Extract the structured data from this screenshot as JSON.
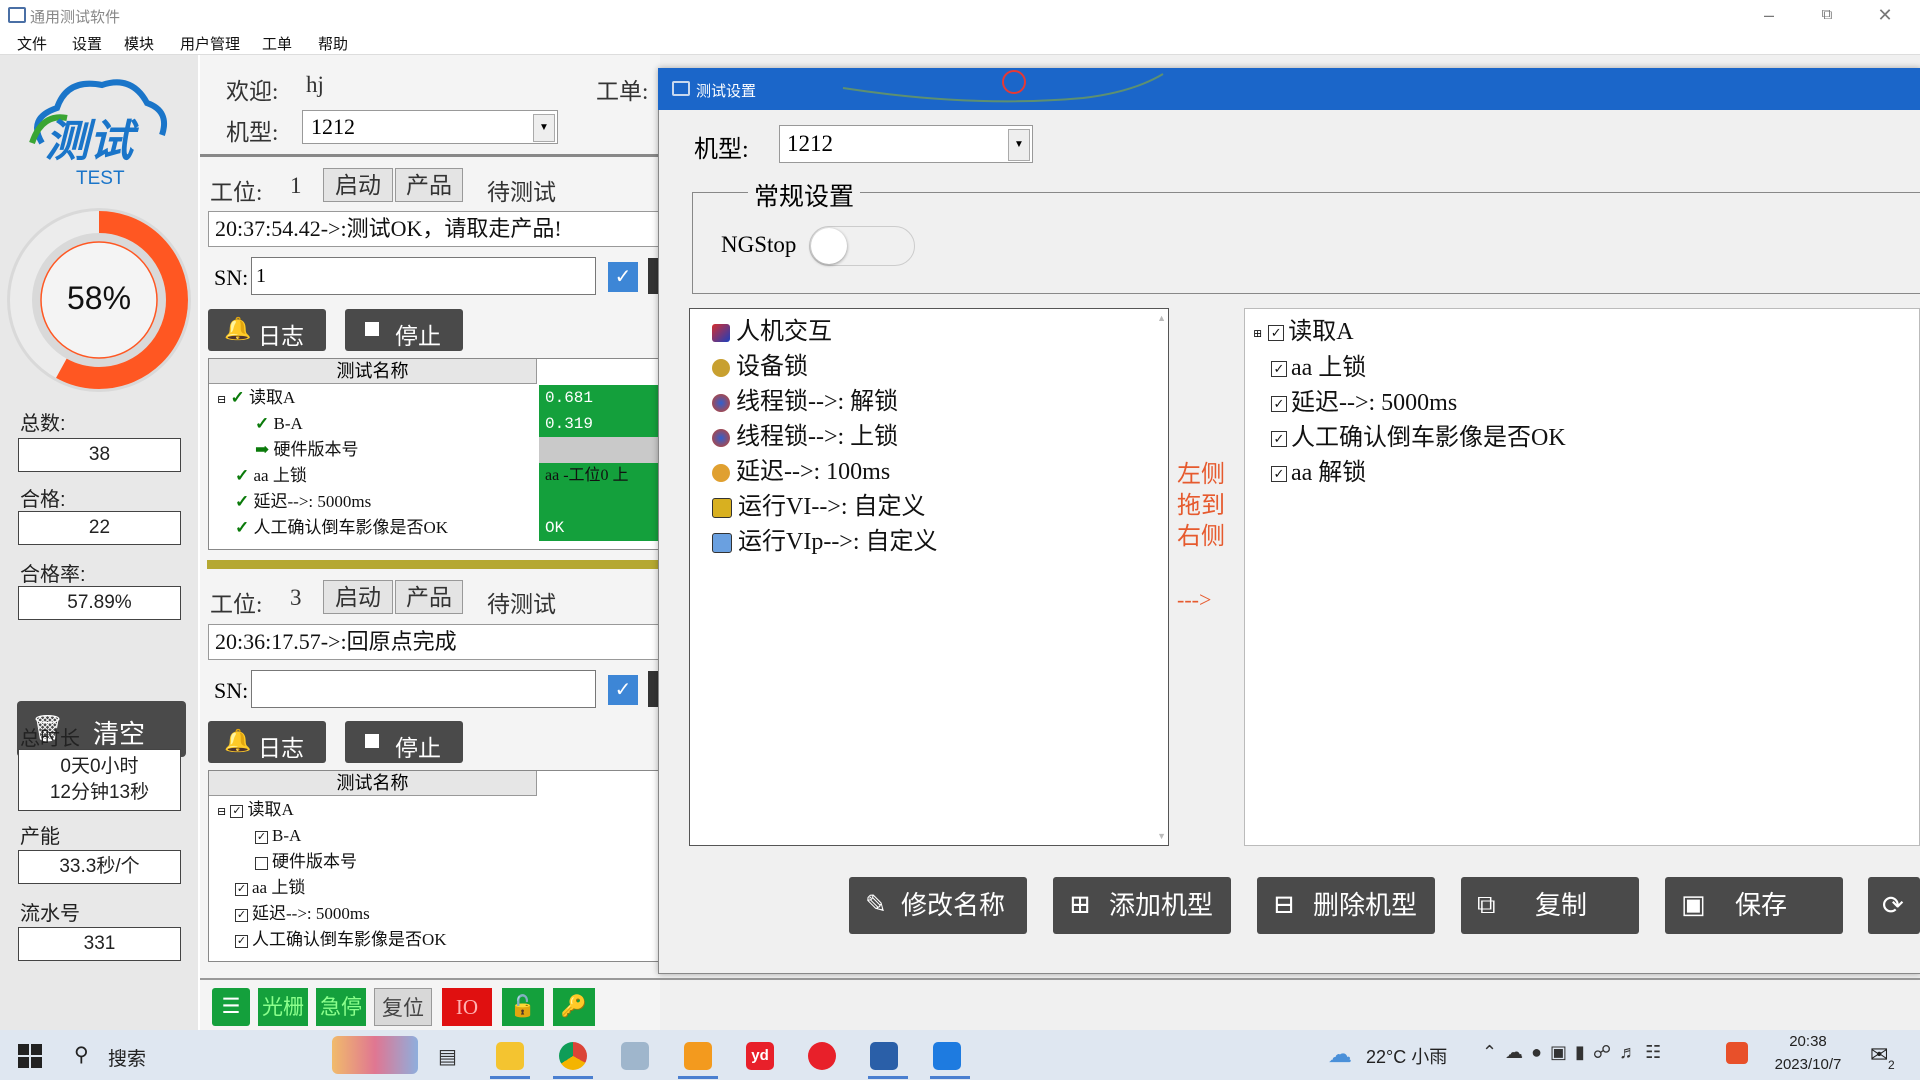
{
  "window": {
    "title": "通用测试软件",
    "menu": [
      "文件",
      "设置",
      "模块",
      "用户管理",
      "工单",
      "帮助"
    ]
  },
  "left": {
    "logo_text": "测试",
    "logo_sub": "TEST",
    "progress": {
      "percent_label": "58%",
      "value": 0.58
    },
    "total_label": "总数:",
    "total": "38",
    "pass_label": "合格:",
    "pass": "22",
    "rate_label": "合格率:",
    "rate": "57.89%",
    "clear_label": "清空",
    "duration_label": "总时长",
    "duration_line1": "0天0小时",
    "duration_line2": "12分钟13秒",
    "capacity_label": "产能",
    "capacity": "33.3秒/个",
    "serial_label": "流水号",
    "serial": "331"
  },
  "middle": {
    "welcome_label": "欢迎:",
    "user": "hj",
    "order_label": "工单:",
    "model_label": "机型:",
    "model_value": "1212",
    "stations": [
      {
        "label": "工位:",
        "number": "1",
        "start": "启动",
        "product": "产品",
        "status": "待测试",
        "message": "20:37:54.42->:测试OK，请取走产品!",
        "sn_label": "SN:",
        "sn_value": "1",
        "log": "日志",
        "stop": "停止",
        "header": "测试名称",
        "rows": [
          {
            "name": "读取A",
            "value": "0.681"
          },
          {
            "name": "B-A",
            "value": "0.319"
          },
          {
            "name": "硬件版本号",
            "value": ""
          },
          {
            "name": "aa  上锁",
            "value": "aa -工位0 上"
          },
          {
            "name": "延迟-->: 5000ms",
            "value": ""
          },
          {
            "name": "人工确认倒车影像是否OK",
            "value": "OK"
          }
        ]
      },
      {
        "label": "工位:",
        "number": "3",
        "start": "启动",
        "product": "产品",
        "status": "待测试",
        "message": "20:36:17.57->:回原点完成",
        "sn_label": "SN:",
        "sn_value": "",
        "log": "日志",
        "stop": "停止",
        "header": "测试名称",
        "rows": [
          {
            "name": "读取A"
          },
          {
            "name": "B-A"
          },
          {
            "name": "硬件版本号"
          },
          {
            "name": "aa  上锁"
          },
          {
            "name": "延迟-->: 5000ms"
          },
          {
            "name": "人工确认倒车影像是否OK"
          }
        ]
      }
    ],
    "toolbar": {
      "light": "光栅",
      "estop": "急停",
      "reset": "复位",
      "io": "IO"
    }
  },
  "dialog": {
    "title": "测试设置",
    "model_label": "机型:",
    "model_value": "1212",
    "group_title": "常规设置",
    "ngstop_label": "NGStop",
    "left_tree": [
      "人机交互",
      "设备锁",
      "线程锁-->: 解锁",
      "线程锁-->: 上锁",
      "延迟-->: 100ms",
      "运行VI-->: 自定义",
      "运行VIp-->: 自定义"
    ],
    "hint_lines": [
      "左侧",
      "拖到",
      "右侧"
    ],
    "arrow": "--->",
    "right_tree": [
      "读取A",
      "aa   上锁",
      "延迟-->: 5000ms",
      "人工确认倒车影像是否OK",
      "aa   解锁"
    ],
    "buttons": [
      "修改名称",
      "添加机型",
      "删除机型",
      "复制",
      "保存"
    ]
  },
  "taskbar": {
    "search": "搜索",
    "weather": "22°C 小雨",
    "time": "20:38",
    "date": "2023/10/7",
    "notifications": "2"
  },
  "colors": {
    "accent_blue": "#1b66c9",
    "progress_orange": "#ff5722",
    "status_green": "#14a03c",
    "button_dark": "#4a4a4a"
  }
}
